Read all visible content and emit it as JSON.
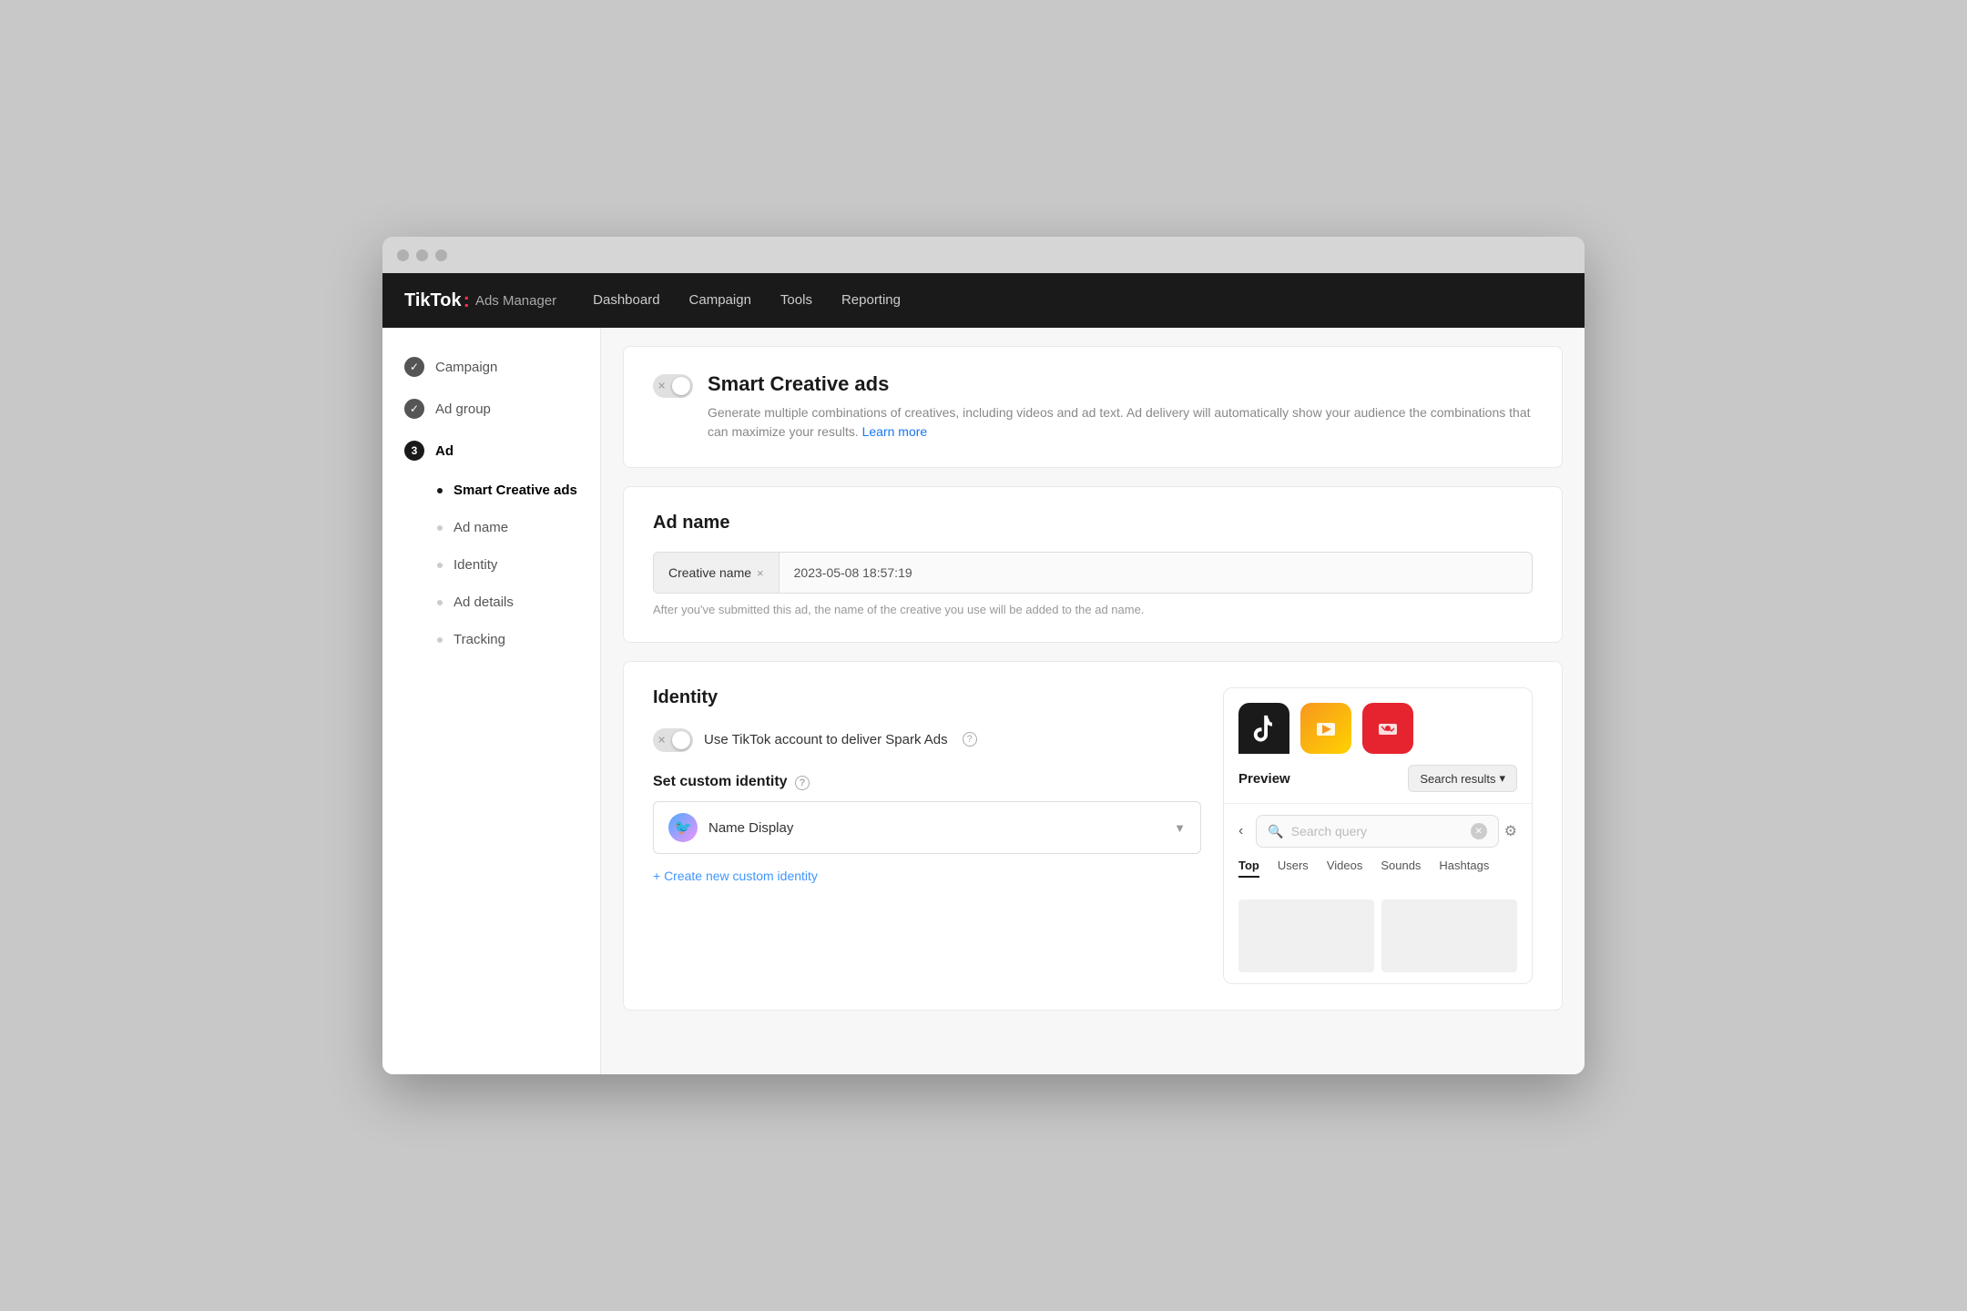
{
  "window": {
    "title": "TikTok Ads Manager"
  },
  "topnav": {
    "logo_tiktok": "TikTok",
    "logo_dot": ":",
    "logo_ads": "Ads Manager",
    "links": [
      {
        "label": "Dashboard",
        "id": "dashboard"
      },
      {
        "label": "Campaign",
        "id": "campaign"
      },
      {
        "label": "Tools",
        "id": "tools"
      },
      {
        "label": "Reporting",
        "id": "reporting"
      }
    ]
  },
  "sidebar": {
    "items": [
      {
        "id": "campaign",
        "label": "Campaign",
        "type": "check",
        "checked": true
      },
      {
        "id": "ad-group",
        "label": "Ad group",
        "type": "check",
        "checked": true
      },
      {
        "id": "ad",
        "label": "Ad",
        "type": "number",
        "number": "3"
      },
      {
        "id": "smart-creative-ads",
        "label": "Smart Creative ads",
        "type": "dot",
        "active": true
      },
      {
        "id": "ad-name-sub",
        "label": "Ad name",
        "type": "dot"
      },
      {
        "id": "identity-sub",
        "label": "Identity",
        "type": "dot"
      },
      {
        "id": "ad-details-sub",
        "label": "Ad details",
        "type": "dot"
      },
      {
        "id": "tracking-sub",
        "label": "Tracking",
        "type": "dot"
      }
    ]
  },
  "smart_creative": {
    "title": "Smart Creative ads",
    "description": "Generate multiple combinations of creatives, including videos and ad text. Ad delivery will automatically show your audience the combinations that can maximize your results.",
    "learn_more": "Learn more"
  },
  "ad_name": {
    "section_title": "Ad name",
    "tag_label": "Creative name",
    "tag_x": "×",
    "value": "2023-05-08 18:57:19",
    "hint": "After you've submitted this ad, the name of the creative you use will be added to the ad name."
  },
  "identity": {
    "section_title": "Identity",
    "spark_ads_label": "Use TikTok account to deliver Spark Ads",
    "custom_identity_label": "Set custom identity",
    "dropdown_name": "Name Display",
    "create_link": "+ Create new custom identity"
  },
  "preview": {
    "tab_label": "Preview",
    "search_results_label": "Search results",
    "search_placeholder": "Search query",
    "tabs": [
      "Top",
      "Users",
      "Videos",
      "Sounds",
      "Hashtags"
    ]
  }
}
